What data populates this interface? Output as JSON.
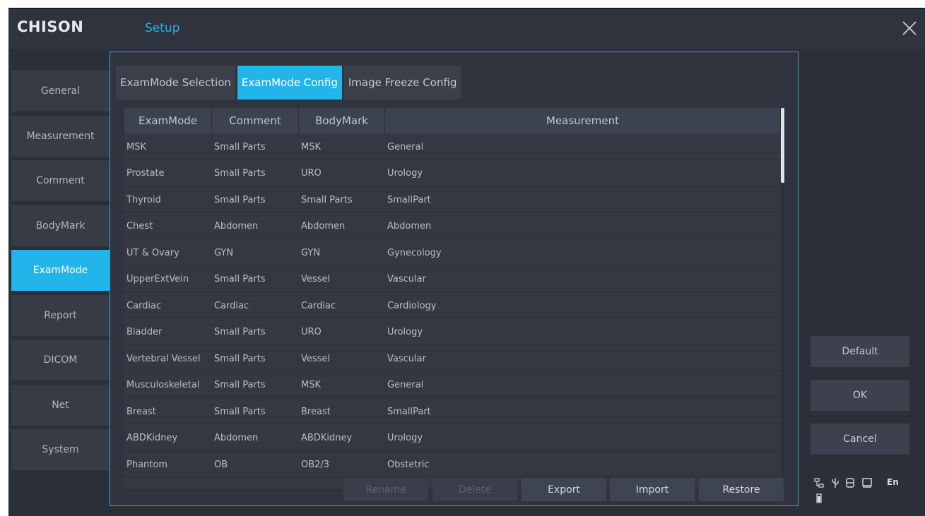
{
  "app": {
    "brand": "CHISON",
    "title": "Setup"
  },
  "icons": {
    "close": "close-icon",
    "network": "network-icon",
    "usb": "usb-icon",
    "storage": "storage-icon",
    "monitor": "monitor-icon",
    "battery": "battery-icon"
  },
  "colors": {
    "accent": "#23b4ea",
    "background": "#2b2f38",
    "panel_border": "#2aa7dc"
  },
  "sidebar": {
    "items": [
      {
        "label": "General",
        "active": false
      },
      {
        "label": "Measurement",
        "active": false
      },
      {
        "label": "Comment",
        "active": false
      },
      {
        "label": "BodyMark",
        "active": false
      },
      {
        "label": "ExamMode",
        "active": true
      },
      {
        "label": "Report",
        "active": false
      },
      {
        "label": "DICOM",
        "active": false
      },
      {
        "label": "Net",
        "active": false
      },
      {
        "label": "System",
        "active": false
      }
    ]
  },
  "tabs": [
    {
      "label": "ExamMode Selection",
      "active": false
    },
    {
      "label": "ExamMode Config",
      "active": true
    },
    {
      "label": "Image Freeze Config",
      "active": false
    }
  ],
  "table": {
    "columns": [
      "ExamMode",
      "Comment",
      "BodyMark",
      "Measurement"
    ],
    "rows": [
      [
        "MSK",
        "Small Parts",
        "MSK",
        "General"
      ],
      [
        "Prostate",
        "Small Parts",
        "URO",
        "Urology"
      ],
      [
        "Thyroid",
        "Small Parts",
        "Small Parts",
        "SmallPart"
      ],
      [
        "Chest",
        "Abdomen",
        "Abdomen",
        "Abdomen"
      ],
      [
        "UT & Ovary",
        "GYN",
        "GYN",
        "Gynecology"
      ],
      [
        "UpperExtVein",
        "Small Parts",
        "Vessel",
        "Vascular"
      ],
      [
        "Cardiac",
        "Cardiac",
        "Cardiac",
        "Cardiology"
      ],
      [
        "Bladder",
        "Small Parts",
        "URO",
        "Urology"
      ],
      [
        "Vertebral Vessel",
        "Small Parts",
        "Vessel",
        "Vascular"
      ],
      [
        "Musculoskeletal",
        "Small Parts",
        "MSK",
        "General"
      ],
      [
        "Breast",
        "Small Parts",
        "Breast",
        "SmallPart"
      ],
      [
        "ABDKidney",
        "Abdomen",
        "ABDKidney",
        "Urology"
      ],
      [
        "Phantom",
        "OB",
        "OB2/3",
        "Obstetric"
      ]
    ]
  },
  "actions": {
    "rename": "Rename",
    "delete": "Delete",
    "export": "Export",
    "import": "Import",
    "restore": "Restore"
  },
  "right_buttons": {
    "default": "Default",
    "ok": "OK",
    "cancel": "Cancel"
  },
  "status": {
    "language": "En"
  }
}
